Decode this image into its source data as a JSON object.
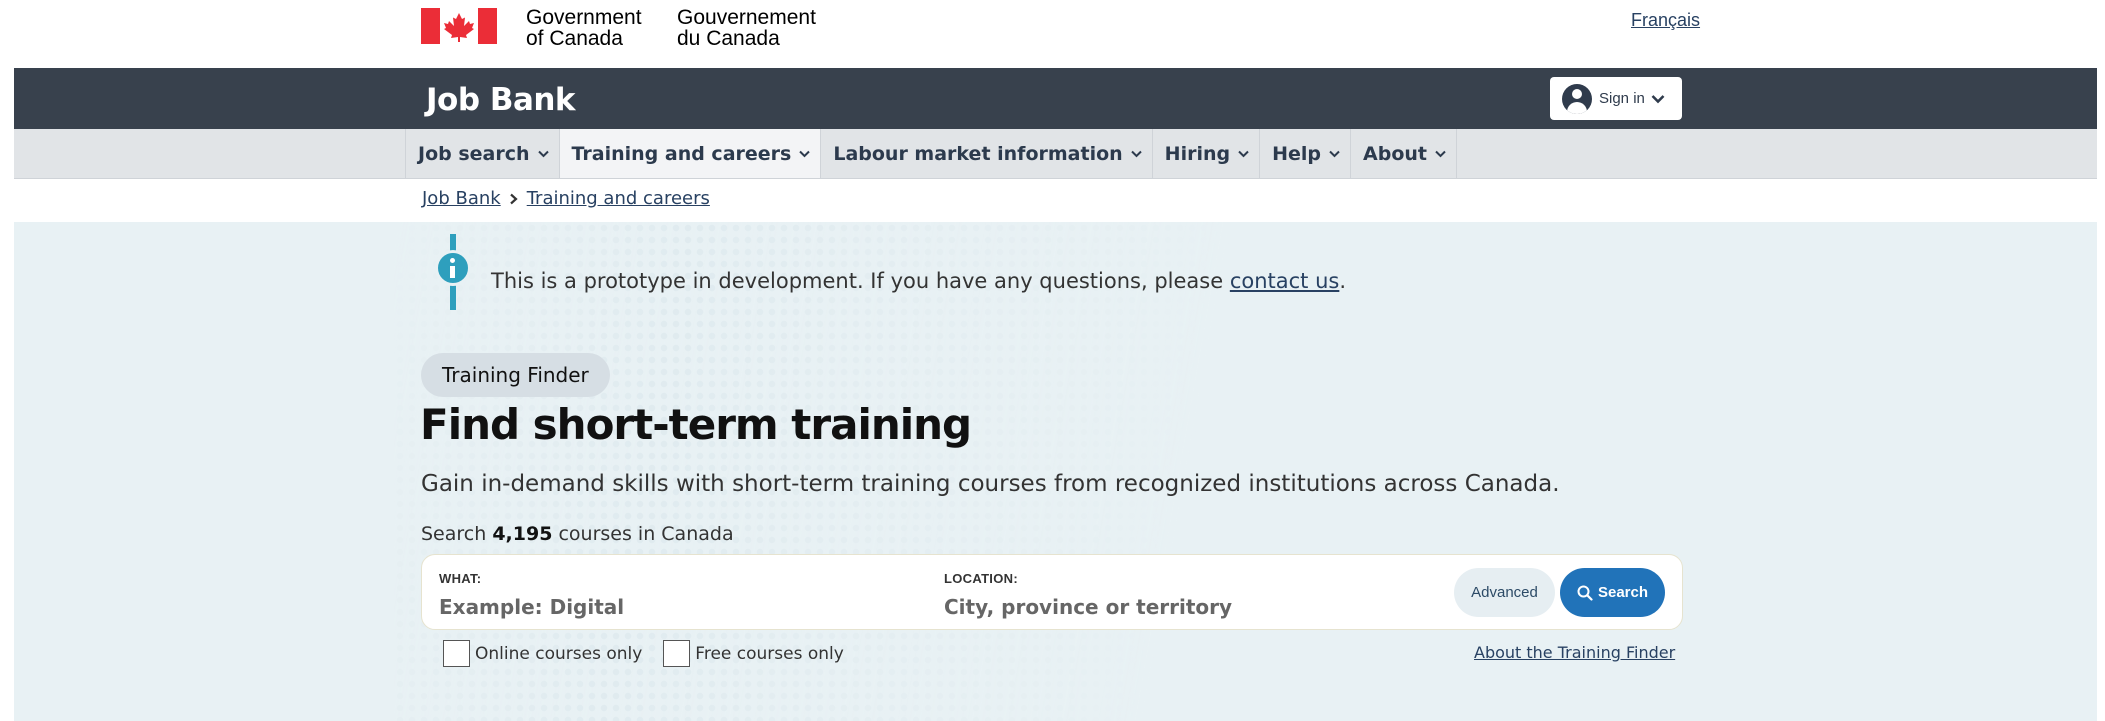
{
  "gov_header": {
    "english_line1": "Government",
    "english_line2": "of Canada",
    "french_line1": "Gouvernement",
    "french_line2": "du Canada",
    "language_toggle": "Français"
  },
  "app_bar": {
    "title": "Job Bank",
    "signin_label": "Sign in"
  },
  "nav": {
    "items": [
      {
        "label": "Job search",
        "active": false
      },
      {
        "label": "Training and careers",
        "active": true
      },
      {
        "label": "Labour market information",
        "active": false
      },
      {
        "label": "Hiring",
        "active": false
      },
      {
        "label": "Help",
        "active": false
      },
      {
        "label": "About",
        "active": false
      }
    ]
  },
  "breadcrumb": {
    "items": [
      "Job Bank",
      "Training and careers"
    ]
  },
  "notice": {
    "text_before": "This is a prototype in development. If you have any questions, please ",
    "link": "contact us",
    "text_after": "."
  },
  "hero": {
    "pill": "Training Finder",
    "title": "Find short-term training",
    "subtitle": "Gain in-demand skills with short-term training courses from recognized institutions across Canada.",
    "count_prefix": "Search ",
    "count_value": "4,195",
    "count_suffix": " courses in Canada"
  },
  "search": {
    "what_label": "WHAT:",
    "what_placeholder": "Example: Digital",
    "location_label": "LOCATION:",
    "location_placeholder": "City, province or territory",
    "advanced_label": "Advanced",
    "search_label": "Search"
  },
  "filters": {
    "online_label": "Online courses only",
    "online_checked": false,
    "free_label": "Free courses only",
    "free_checked": false
  },
  "about_link": "About the Training Finder",
  "colors": {
    "app_bar": "#38414d",
    "nav_bg": "#e1e4e7",
    "hero_bg": "#e8f1f4",
    "link": "#284162",
    "primary_button": "#2173b9",
    "info_accent": "#2e9fbd",
    "flag_red": "#eb2d37"
  }
}
